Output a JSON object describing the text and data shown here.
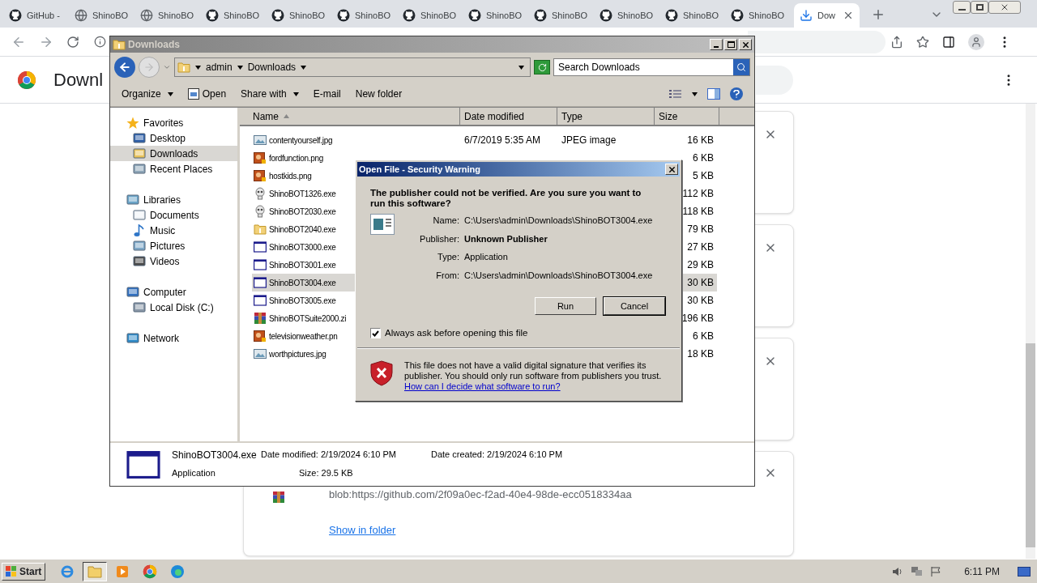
{
  "browser": {
    "tabs": [
      {
        "title": "GitHub -",
        "kind": "github",
        "selected": false
      },
      {
        "title": "ShinoBO",
        "kind": "globe",
        "selected": false
      },
      {
        "title": "ShinoBO",
        "kind": "globe",
        "selected": false
      },
      {
        "title": "ShinoBO",
        "kind": "github",
        "selected": false
      },
      {
        "title": "ShinoBO",
        "kind": "github",
        "selected": false
      },
      {
        "title": "ShinoBO",
        "kind": "github",
        "selected": false
      },
      {
        "title": "ShinoBO",
        "kind": "github",
        "selected": false
      },
      {
        "title": "ShinoBO",
        "kind": "github",
        "selected": false
      },
      {
        "title": "ShinoBO",
        "kind": "github",
        "selected": false
      },
      {
        "title": "ShinoBO",
        "kind": "github",
        "selected": false
      },
      {
        "title": "ShinoBO",
        "kind": "github",
        "selected": false
      },
      {
        "title": "ShinoBO",
        "kind": "github",
        "selected": false
      },
      {
        "title": "Dow",
        "kind": "download",
        "selected": true
      }
    ],
    "page_title": "Downl",
    "download_cards": [
      {
        "kind": "covered"
      },
      {
        "kind": "covered"
      },
      {
        "kind": "covered"
      },
      {
        "kind": "archive",
        "url": "blob:https://github.com/2f09a0ec-f2ad-40e4-98de-ecc0518334aa",
        "link": "Show in folder"
      }
    ]
  },
  "explorer": {
    "title": "Downloads",
    "breadcrumb": [
      "admin",
      "Downloads"
    ],
    "search": {
      "placeholder": "Search Downloads"
    },
    "toolbar": [
      {
        "label": "Organize",
        "kind": "menu"
      },
      {
        "label": "Open",
        "kind": "open"
      },
      {
        "label": "Share with",
        "kind": "menu"
      },
      {
        "label": "E-mail",
        "kind": "plain"
      },
      {
        "label": "New folder",
        "kind": "plain"
      }
    ],
    "nav": [
      {
        "label": "Favorites",
        "kind": "star",
        "selected": false,
        "children": [
          {
            "label": "Desktop",
            "kind": "desktop",
            "selected": false
          },
          {
            "label": "Downloads",
            "kind": "downloads",
            "selected": true
          },
          {
            "label": "Recent Places",
            "kind": "recent",
            "selected": false
          }
        ]
      },
      {
        "label": "Libraries",
        "kind": "libraries",
        "selected": false,
        "children": [
          {
            "label": "Documents",
            "kind": "documents",
            "selected": false
          },
          {
            "label": "Music",
            "kind": "music",
            "selected": false
          },
          {
            "label": "Pictures",
            "kind": "pictures",
            "selected": false
          },
          {
            "label": "Videos",
            "kind": "videos",
            "selected": false
          }
        ]
      },
      {
        "label": "Computer",
        "kind": "computer",
        "selected": false,
        "children": [
          {
            "label": "Local Disk (C:)",
            "kind": "disk",
            "selected": false
          }
        ]
      },
      {
        "label": "Network",
        "kind": "network",
        "selected": false
      }
    ],
    "columns": [
      "Name",
      "Date modified",
      "Type",
      "Size"
    ],
    "files": [
      {
        "name": "contentyourself.jpg",
        "kind": "image",
        "date": "6/7/2019 5:35 AM",
        "type": "JPEG image",
        "size": "16 KB",
        "selected": false
      },
      {
        "name": "fordfunction.png",
        "kind": "png",
        "size": "6 KB",
        "selected": false
      },
      {
        "name": "hostkids.png",
        "kind": "png",
        "size": "5 KB",
        "selected": false
      },
      {
        "name": "ShinoBOT1326.exe",
        "kind": "skull",
        "size": "112 KB",
        "selected": false
      },
      {
        "name": "ShinoBOT2030.exe",
        "kind": "skull",
        "size": "118 KB",
        "selected": false
      },
      {
        "name": "ShinoBOT2040.exe",
        "kind": "installer",
        "size": "79 KB",
        "selected": false
      },
      {
        "name": "ShinoBOT3000.exe",
        "kind": "app",
        "size": "27 KB",
        "selected": false
      },
      {
        "name": "ShinoBOT3001.exe",
        "kind": "app",
        "size": "29 KB",
        "selected": false
      },
      {
        "name": "ShinoBOT3004.exe",
        "kind": "app",
        "size": "30 KB",
        "selected": true
      },
      {
        "name": "ShinoBOT3005.exe",
        "kind": "app",
        "size": "30 KB",
        "selected": false
      },
      {
        "name": "ShinoBOTSuite2000.zi",
        "kind": "archive",
        "size": "196 KB",
        "selected": false
      },
      {
        "name": "televisionweather.pn",
        "kind": "png",
        "size": "6 KB",
        "selected": false
      },
      {
        "name": "worthpictures.jpg",
        "kind": "image",
        "size": "18 KB",
        "selected": false
      }
    ],
    "details": {
      "name": "ShinoBOT3004.exe",
      "type": "Application",
      "modified_label": "Date modified:",
      "modified": "2/19/2024 6:10 PM",
      "size_label": "Size:",
      "size": "29.5 KB",
      "created_label": "Date created:",
      "created": "2/19/2024 6:10 PM"
    }
  },
  "dialog": {
    "title": "Open File - Security Warning",
    "question": "The publisher could not be verified.  Are you sure you want to run this software?",
    "fields": [
      {
        "label": "Name:",
        "value": "C:\\Users\\admin\\Downloads\\ShinoBOT3004.exe",
        "bold": false
      },
      {
        "label": "Publisher:",
        "value": "Unknown Publisher",
        "bold": true
      },
      {
        "label": "Type:",
        "value": "Application",
        "bold": false
      },
      {
        "label": "From:",
        "value": "C:\\Users\\admin\\Downloads\\ShinoBOT3004.exe",
        "bold": false
      }
    ],
    "buttons": [
      {
        "label": "Run",
        "default": false
      },
      {
        "label": "Cancel",
        "default": true
      }
    ],
    "checkbox": {
      "label": "Always ask before opening this file",
      "checked": true
    },
    "warning": "This file does not have a valid digital signature that verifies its publisher.  You should only run software from publishers you trust.",
    "help_link": "How can I decide what software to run?"
  },
  "taskbar": {
    "start": "Start",
    "apps": [
      {
        "kind": "ie",
        "selected": false
      },
      {
        "kind": "explorer",
        "selected": true
      },
      {
        "kind": "media",
        "selected": false
      },
      {
        "kind": "chrome",
        "selected": false
      },
      {
        "kind": "edge",
        "selected": false
      }
    ],
    "clock": "6:11 PM"
  }
}
